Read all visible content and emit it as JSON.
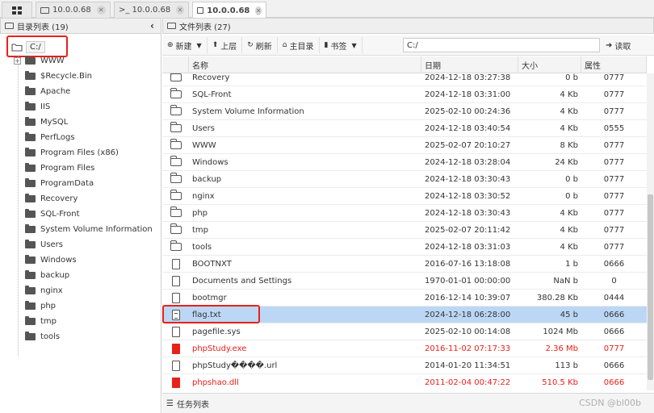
{
  "tabs": [
    {
      "label": "10.0.0.68",
      "glyph": "folder"
    },
    {
      "label": ">_ 10.0.0.68",
      "glyph": "terminal"
    },
    {
      "label": "10.0.0.68",
      "glyph": "folder",
      "active": true
    }
  ],
  "left": {
    "title": "目录列表 (19)",
    "collapse_glyph": "‹",
    "root": "C:/",
    "items": [
      "WWW",
      "$Recycle.Bin",
      "Apache",
      "IIS",
      "MySQL",
      "PerfLogs",
      "Program Files (x86)",
      "Program Files",
      "ProgramData",
      "Recovery",
      "SQL-Front",
      "System Volume Information",
      "Users",
      "Windows",
      "backup",
      "nginx",
      "php",
      "tmp",
      "tools"
    ],
    "expand_glyph": "+"
  },
  "right": {
    "title": "文件列表 (27)",
    "toolbar": {
      "new_label": "新建",
      "up_label": "上层",
      "refresh_label": "刷新",
      "home_label": "主目录",
      "bookmark_label": "书签",
      "path_value": "C:/",
      "read_label": "读取"
    },
    "columns": {
      "name": "名称",
      "date": "日期",
      "size": "大小",
      "perm": "属性"
    },
    "files": [
      {
        "name": "Recovery",
        "date": "2024-12-18 03:27:38",
        "size": "0 b",
        "perm": "0777",
        "type": "folder"
      },
      {
        "name": "SQL-Front",
        "date": "2024-12-18 03:31:00",
        "size": "4 Kb",
        "perm": "0777",
        "type": "folder"
      },
      {
        "name": "System Volume Information",
        "date": "2025-02-10 00:24:36",
        "size": "4 Kb",
        "perm": "0777",
        "type": "folder"
      },
      {
        "name": "Users",
        "date": "2024-12-18 03:40:54",
        "size": "4 Kb",
        "perm": "0555",
        "type": "folder"
      },
      {
        "name": "WWW",
        "date": "2025-02-07 20:10:27",
        "size": "8 Kb",
        "perm": "0777",
        "type": "folder"
      },
      {
        "name": "Windows",
        "date": "2024-12-18 03:28:04",
        "size": "24 Kb",
        "perm": "0777",
        "type": "folder"
      },
      {
        "name": "backup",
        "date": "2024-12-18 03:30:43",
        "size": "0 b",
        "perm": "0777",
        "type": "folder"
      },
      {
        "name": "nginx",
        "date": "2024-12-18 03:30:52",
        "size": "0 b",
        "perm": "0777",
        "type": "folder"
      },
      {
        "name": "php",
        "date": "2024-12-18 03:30:43",
        "size": "4 Kb",
        "perm": "0777",
        "type": "folder"
      },
      {
        "name": "tmp",
        "date": "2025-02-07 20:11:42",
        "size": "4 Kb",
        "perm": "0777",
        "type": "folder"
      },
      {
        "name": "tools",
        "date": "2024-12-18 03:31:03",
        "size": "4 Kb",
        "perm": "0777",
        "type": "folder"
      },
      {
        "name": "BOOTNXT",
        "date": "2016-07-16 13:18:08",
        "size": "1 b",
        "perm": "0666",
        "type": "file"
      },
      {
        "name": "Documents and Settings",
        "date": "1970-01-01 00:00:00",
        "size": "NaN b",
        "perm": "0",
        "type": "file"
      },
      {
        "name": "bootmgr",
        "date": "2016-12-14 10:39:07",
        "size": "380.28 Kb",
        "perm": "0444",
        "type": "file"
      },
      {
        "name": "flag.txt",
        "date": "2024-12-18 06:28:00",
        "size": "45 b",
        "perm": "0666",
        "type": "txt",
        "selected": true
      },
      {
        "name": "pagefile.sys",
        "date": "2025-02-10 00:14:08",
        "size": "1024 Mb",
        "perm": "0666",
        "type": "file"
      },
      {
        "name": "phpStudy.exe",
        "date": "2016-11-02 07:17:33",
        "size": "2.36 Mb",
        "perm": "0777",
        "type": "red"
      },
      {
        "name": "phpStudy����.url",
        "date": "2014-01-20 11:34:51",
        "size": "113 b",
        "perm": "0666",
        "type": "file"
      },
      {
        "name": "phpshao.dll",
        "date": "2011-02-04 00:47:22",
        "size": "510.5 Kb",
        "perm": "0666",
        "type": "red"
      }
    ],
    "task_label": "任务列表"
  },
  "watermark": "CSDN @bl00b",
  "colors": {
    "selected_row": "#bcd7f5",
    "highlight": "#e8201b",
    "danger_text": "#e8201b"
  }
}
